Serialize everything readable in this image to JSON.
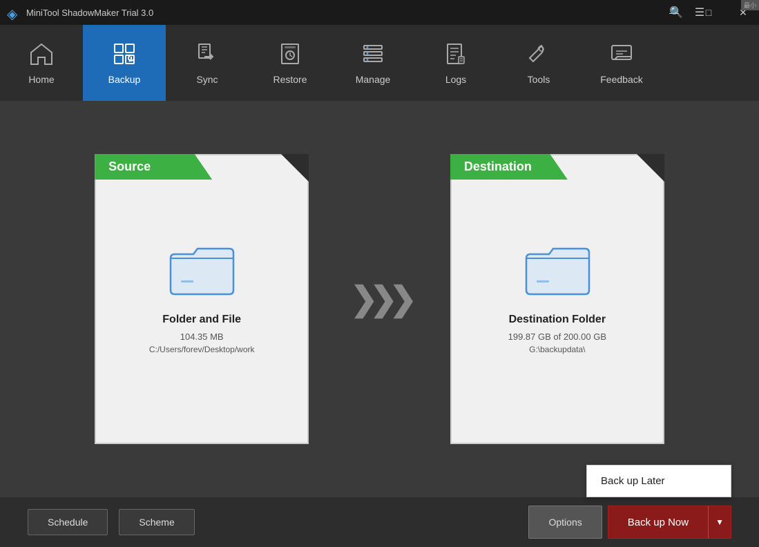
{
  "titlebar": {
    "title": "MiniTool ShadowMaker Trial 3.0",
    "logo": "◈",
    "corner_label": "最小",
    "controls": {
      "search": "🔍",
      "menu": "☰",
      "minimize": "—",
      "maximize": "□",
      "close": "✕"
    }
  },
  "navbar": {
    "items": [
      {
        "id": "home",
        "label": "Home",
        "icon": "home",
        "active": false
      },
      {
        "id": "backup",
        "label": "Backup",
        "icon": "backup",
        "active": true
      },
      {
        "id": "sync",
        "label": "Sync",
        "icon": "sync",
        "active": false
      },
      {
        "id": "restore",
        "label": "Restore",
        "icon": "restore",
        "active": false
      },
      {
        "id": "manage",
        "label": "Manage",
        "icon": "manage",
        "active": false
      },
      {
        "id": "logs",
        "label": "Logs",
        "icon": "logs",
        "active": false
      },
      {
        "id": "tools",
        "label": "Tools",
        "icon": "tools",
        "active": false
      },
      {
        "id": "feedback",
        "label": "Feedback",
        "icon": "feedback",
        "active": false
      }
    ]
  },
  "source": {
    "header": "Source",
    "title": "Folder and File",
    "size": "104.35 MB",
    "path": "C:/Users/forev/Desktop/work"
  },
  "destination": {
    "header": "Destination",
    "title": "Destination Folder",
    "size": "199.87 GB of 200.00 GB",
    "path": "G:\\backupdata\\"
  },
  "bottombar": {
    "schedule_label": "Schedule",
    "scheme_label": "Scheme",
    "options_label": "Options",
    "backup_now_label": "Back up Now",
    "backup_later_label": "Back up Later"
  }
}
